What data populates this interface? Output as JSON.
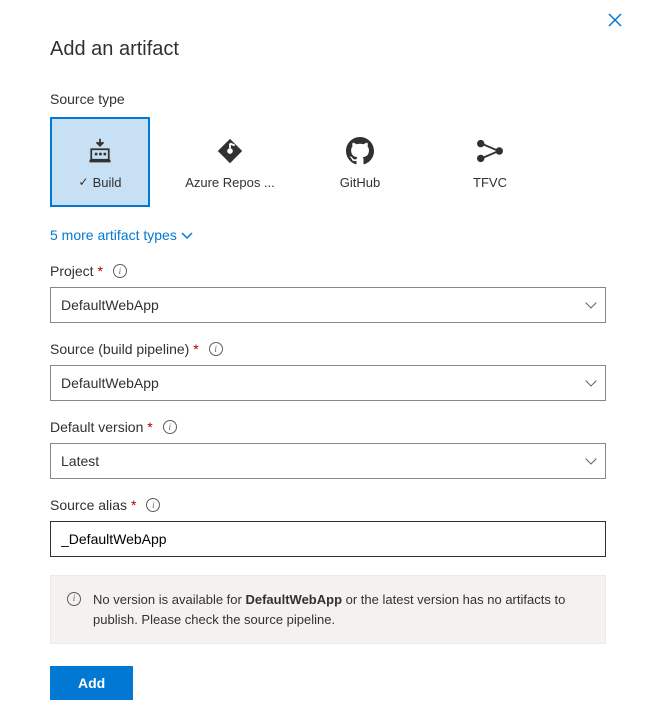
{
  "title": "Add an artifact",
  "sourceType": {
    "label": "Source type",
    "tiles": [
      {
        "key": "build",
        "label": "Build",
        "selected": true
      },
      {
        "key": "azrepos",
        "label": "Azure Repos ...",
        "selected": false
      },
      {
        "key": "github",
        "label": "GitHub",
        "selected": false
      },
      {
        "key": "tfvc",
        "label": "TFVC",
        "selected": false
      }
    ],
    "moreLink": "5 more artifact types"
  },
  "fields": {
    "project": {
      "label": "Project",
      "value": "DefaultWebApp"
    },
    "source": {
      "label": "Source (build pipeline)",
      "value": "DefaultWebApp"
    },
    "version": {
      "label": "Default version",
      "value": "Latest"
    },
    "alias": {
      "label": "Source alias",
      "value": "_DefaultWebApp"
    }
  },
  "message": {
    "prefix": "No version is available for ",
    "bold": "DefaultWebApp",
    "suffix": " or the latest version has no artifacts to publish. Please check the source pipeline."
  },
  "addButton": "Add"
}
